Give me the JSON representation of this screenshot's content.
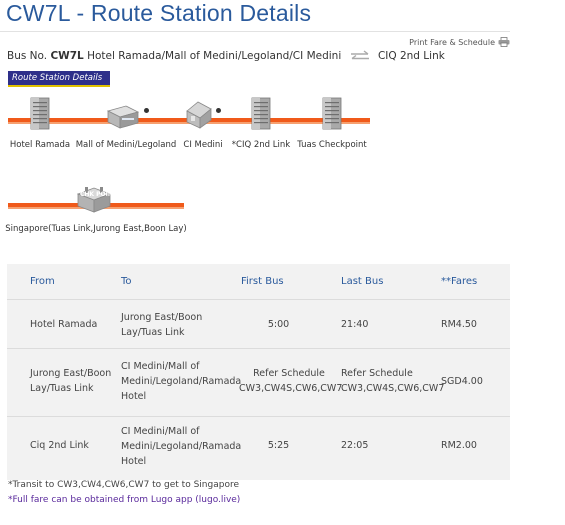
{
  "page_title": "CW7L - Route Station Details",
  "print_link": "Print Fare & Schedule",
  "bus": {
    "prefix": "Bus No.",
    "code": "CW7L",
    "origin": "Hotel Ramada/Mall of Medini/Legoland/CI Medini",
    "destination": "CIQ 2nd Link"
  },
  "section_tab": "Route Station Details",
  "stations_row1": [
    {
      "name": "Hotel Ramada",
      "icon": "building-icon"
    },
    {
      "name": "Mall of Medini/Legoland",
      "icon": "mall-icon"
    },
    {
      "name": "CI Medini",
      "icon": "house-icon"
    },
    {
      "name": "*CIQ 2nd Link",
      "icon": "building-icon"
    },
    {
      "name": "Tuas Checkpoint",
      "icon": "building-icon"
    }
  ],
  "stations_row2": [
    {
      "name": "Singapore(Tuas Link,Jurong East,Boon Lay)",
      "icon": "checkpoint-icon"
    }
  ],
  "checkpoint_sign": "CHK POINT",
  "table": {
    "headers": [
      "From",
      "To",
      "First Bus",
      "Last Bus",
      "**Fares"
    ],
    "rows": [
      {
        "from": "Hotel Ramada",
        "to": "Jurong East/Boon Lay/Tuas Link",
        "first": "5:00",
        "last": "21:40",
        "fare": "RM4.50"
      },
      {
        "from": "Jurong East/Boon Lay/Tuas Link",
        "to": "CI Medini/Mall of Medini/Legoland/Ramada Hotel",
        "first": "Refer Schedule CW3,CW4S,CW6,CW7",
        "last": "Refer Schedule CW3,CW4S,CW6,CW7",
        "fare": "SGD4.00"
      },
      {
        "from": "Ciq 2nd Link",
        "to": "CI Medini/Mall of Medini/Legoland/Ramada Hotel",
        "first": "5:25",
        "last": "22:05",
        "fare": "RM2.00"
      }
    ]
  },
  "footnotes": {
    "transit": "*Transit to CW3,CW4,CW6,CW7 to get to Singapore",
    "fare": "*Full fare can be obtained from Lugo app (lugo.live)"
  },
  "colors": {
    "title": "#2a5a9c",
    "route_line": "#f05a1a",
    "tab_bg": "#2e2f8a",
    "fare_note": "#5a2a9c"
  }
}
